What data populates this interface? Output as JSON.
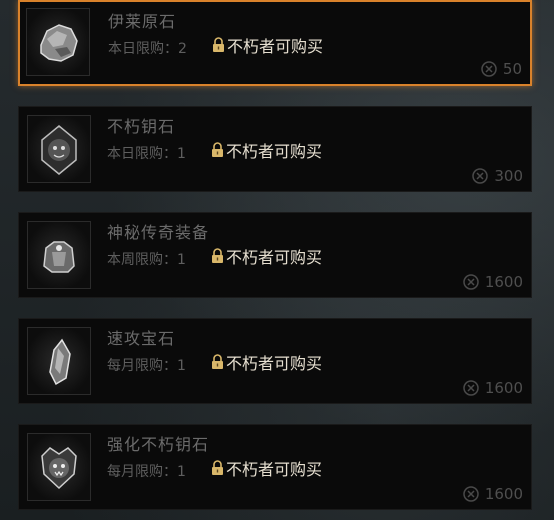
{
  "items": [
    {
      "name": "伊莱原石",
      "limit_label": "本日限购：",
      "limit_value": "2",
      "lock_text": "不朽者可购买",
      "price": "50",
      "icon": "rough-stone-icon",
      "selected": true
    },
    {
      "name": "不朽钥石",
      "limit_label": "本日限购：",
      "limit_value": "1",
      "lock_text": "不朽者可购买",
      "price": "300",
      "icon": "demon-key-icon",
      "selected": false
    },
    {
      "name": "神秘传奇装备",
      "limit_label": "本周限购：",
      "limit_value": "1",
      "lock_text": "不朽者可购买",
      "price": "1600",
      "icon": "armor-icon",
      "selected": false
    },
    {
      "name": "速攻宝石",
      "limit_label": "每月限购：",
      "limit_value": "1",
      "lock_text": "不朽者可购买",
      "price": "1600",
      "icon": "crystal-icon",
      "selected": false
    },
    {
      "name": "强化不朽钥石",
      "limit_label": "每月限购：",
      "limit_value": "1",
      "lock_text": "不朽者可购买",
      "price": "1600",
      "icon": "empowered-key-icon",
      "selected": false
    }
  ],
  "colors": {
    "selected_border": "#d9822b",
    "lock_text": "#e6dfd0",
    "dim_text": "#6b6b6b"
  }
}
